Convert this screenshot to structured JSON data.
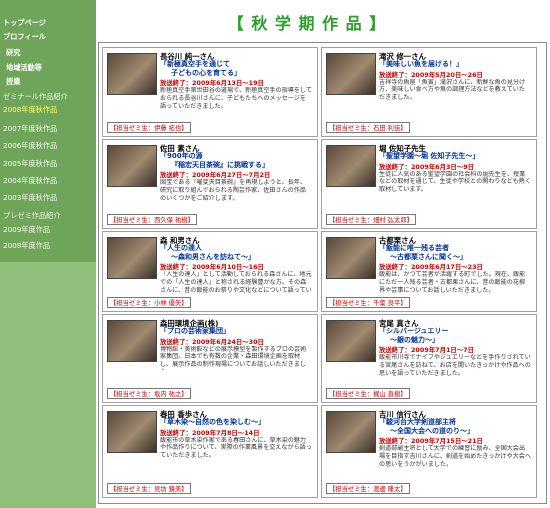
{
  "page": {
    "title": "【 秋 学 期 作 品 】"
  },
  "sidebar": {
    "items": [
      {
        "label": "トップページ",
        "kind": "main"
      },
      {
        "label": "プロフィール",
        "kind": "main"
      },
      {
        "label": "研究",
        "kind": "main"
      },
      {
        "label": "地域活動等",
        "kind": "main"
      },
      {
        "label": "授業",
        "kind": "main"
      },
      {
        "label": "ゼミナール作品紹介",
        "kind": "sec"
      },
      {
        "label": "2008年度秋作品",
        "kind": "active"
      },
      {
        "label": "2007年度秋作品",
        "kind": "plain"
      },
      {
        "label": "2006年度秋作品",
        "kind": "plain"
      },
      {
        "label": "2005年度秋作品",
        "kind": "plain"
      },
      {
        "label": "2004年度秋作品",
        "kind": "plain"
      },
      {
        "label": "2003年度秋作品",
        "kind": "plain"
      },
      {
        "label": "プレゼミ作品紹介",
        "kind": "sec"
      },
      {
        "label": "2009年度作品",
        "kind": "plain"
      },
      {
        "label": "2008年度作品",
        "kind": "plain"
      }
    ]
  },
  "cards": [
    {
      "name": "長谷川 純一さん",
      "subtitle": [
        "「新極真空手を通じて",
        "子どもの心を育てる」"
      ],
      "date": "放送終了：2009年6月13日〜19日",
      "desc": "新極真空手第世田谷の道場で、新極真空手の指導をしておられる長谷川さんに、子どもたちへのメッセージを語っていただきました。",
      "credit": "【担当ゼミ生：伊藤 拓也】"
    },
    {
      "name": "滝沢 修一さん",
      "subtitle": [
        "「美味しい魚を届ける！」"
      ],
      "date": "放送終了：2009年5月20日〜26日",
      "desc": "吉祥寺の魚屋「魚寅」滝沢さんに、新鮮な魚の見分け方、美味しい食べ方や魚の調理方法などを教えていただきました。",
      "credit": "【担当ゼミ生：石田 利佳】"
    },
    {
      "name": "佐田 素さん",
      "subtitle": [
        "「900年の源",
        "『稲宏天目茶碗』に挑戦する」"
      ],
      "date": "放送終了：2009年6月27日〜7月2日",
      "desc": "国宝である『曜変天目茶碗』を再現しようと、長年、研究に取り組んでおられる陶芸作家、佐田さんの作品のいくつかをご紹介します。",
      "credit": "【担当ゼミ生：西久保 祐樹】"
    },
    {
      "name": "堀 佐知子先生",
      "subtitle": [
        "「聖望学園〜堀 佐知子先生〜」"
      ],
      "date": "放送終了：2009年6月3日〜9日",
      "desc": "生徒に人気のある聖望学園の社会科の堀先生を、授業などの取材を通じて、生徒や学校との関わりなども熱く取材しています。",
      "credit": "【担当ゼミ生：畑村 弘太郎】"
    },
    {
      "name": "森 和男さん",
      "subtitle": [
        "「人生の達人",
        "〜森和男さんを訪ねて〜」"
      ],
      "date": "放送終了：2009年6月10日〜16日",
      "desc": "「人生の達人」として活動しておられる森さんに、地元での「人生の達人」と称される経験豊かな方。その森さんに、昔の飯能のお祭りや文化などについて語っていただきました。",
      "credit": "【担当ゼミ生：小林 優矢】"
    },
    {
      "name": "古都栗さん",
      "subtitle": [
        "「飯能に唯一残る芸者",
        "〜古都栗さんに聞く〜」"
      ],
      "date": "放送終了：2009年6月17日〜23日",
      "desc": "飯能は、かつて芸者が活躍する町でした。現在、飯能にただ一人残る芸者・古都栗さんに、昔の飯能の花柳界や芸事についてお話しいただきました。",
      "credit": "【担当ゼミ生：千葉 良平】"
    },
    {
      "name": "森田環境企画(株)",
      "subtitle": [
        "「プロの芸術家集団」"
      ],
      "date": "放送終了：2009年6月24日〜30日",
      "desc": "博物館・美術館などの展示模型を製作するプロの芸術家集団。日本でも有数の企業・森田環境企画を取材し、展示作品の制作現場についてお話しいただきました。",
      "credit": "【担当ゼミ生：坂内 祐之】"
    },
    {
      "name": "宮尾 真さん",
      "subtitle": [
        "「シルバージュエリー",
        "〜銀の魅力〜」"
      ],
      "date": "放送終了：2009年7月1日〜7日",
      "desc": "飯能市川寺でナイフやジュエリーなどを手作りされている宮尾さんを訪ねて、お店を開いたきっかけや作品への思いを語っていただきました。",
      "credit": "【担当ゼミ生：梶山 直樹】"
    },
    {
      "name": "春田 香歩さん",
      "subtitle": [
        "「草木染〜自然の色を染しむ〜」"
      ],
      "date": "放送終了：2009年7月8日〜14日",
      "desc": "飯能市の草木染作家である春田さんに、草木染の魅力や作品作りについて、実際の作業風景を交えながら語っていただきました。",
      "credit": "【担当ゼミ生：見坊 鏡美】"
    },
    {
      "name": "吉川 信行さん",
      "subtitle": [
        "「駿河台大学剣道部主将",
        "〜全国大会への道のり〜」"
      ],
      "date": "放送終了：2009年7月15日〜21日",
      "desc": "剣道部副主将として大学での練習に励み、全国大会出場を目指す吉川さんに、剣道を始めたきっかけや大会への思いをうかがいました。",
      "credit": "【担当ゼミ生：渡邊 隆太】"
    }
  ]
}
